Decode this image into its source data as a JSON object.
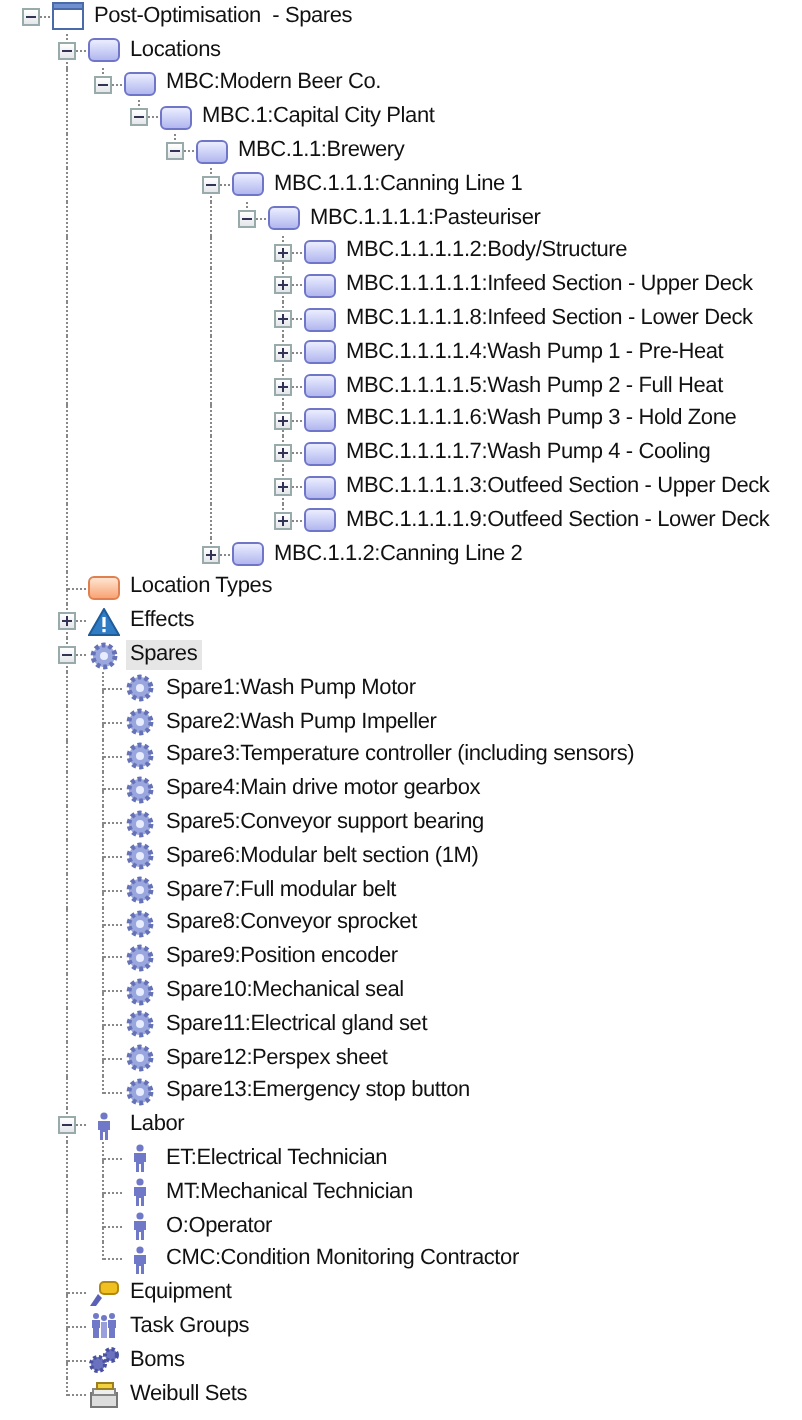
{
  "tree": {
    "label": "Post-Optimisation  - Spares",
    "kind": "root",
    "expanded": true,
    "selected": false,
    "children": [
      {
        "label": "Locations",
        "kind": "location",
        "expanded": true,
        "selected": false,
        "children": [
          {
            "label": "MBC:Modern Beer Co.",
            "kind": "location",
            "expanded": true,
            "selected": false,
            "children": [
              {
                "label": "MBC.1:Capital City Plant",
                "kind": "location",
                "expanded": true,
                "selected": false,
                "children": [
                  {
                    "label": "MBC.1.1:Brewery",
                    "kind": "location",
                    "expanded": true,
                    "selected": false,
                    "children": [
                      {
                        "label": "MBC.1.1.1:Canning Line 1",
                        "kind": "location",
                        "expanded": true,
                        "selected": false,
                        "children": [
                          {
                            "label": "MBC.1.1.1.1:Pasteuriser",
                            "kind": "location",
                            "expanded": true,
                            "selected": false,
                            "children": [
                              {
                                "label": "MBC.1.1.1.1.2:Body/Structure",
                                "kind": "location",
                                "expanded": false,
                                "selected": false
                              },
                              {
                                "label": "MBC.1.1.1.1.1:Infeed Section - Upper Deck",
                                "kind": "location",
                                "expanded": false,
                                "selected": false
                              },
                              {
                                "label": "MBC.1.1.1.1.8:Infeed Section - Lower Deck",
                                "kind": "location",
                                "expanded": false,
                                "selected": false
                              },
                              {
                                "label": "MBC.1.1.1.1.4:Wash Pump 1 - Pre-Heat",
                                "kind": "location",
                                "expanded": false,
                                "selected": false
                              },
                              {
                                "label": "MBC.1.1.1.1.5:Wash Pump 2 - Full Heat",
                                "kind": "location",
                                "expanded": false,
                                "selected": false
                              },
                              {
                                "label": "MBC.1.1.1.1.6:Wash Pump 3 - Hold Zone",
                                "kind": "location",
                                "expanded": false,
                                "selected": false
                              },
                              {
                                "label": "MBC.1.1.1.1.7:Wash Pump 4 - Cooling",
                                "kind": "location",
                                "expanded": false,
                                "selected": false
                              },
                              {
                                "label": "MBC.1.1.1.1.3:Outfeed Section - Upper Deck",
                                "kind": "location",
                                "expanded": false,
                                "selected": false
                              },
                              {
                                "label": "MBC.1.1.1.1.9:Outfeed Section - Lower Deck",
                                "kind": "location",
                                "expanded": false,
                                "selected": false
                              }
                            ]
                          }
                        ]
                      },
                      {
                        "label": "MBC.1.1.2:Canning Line 2",
                        "kind": "location",
                        "expanded": false,
                        "selected": false
                      }
                    ]
                  }
                ]
              }
            ]
          }
        ]
      },
      {
        "label": "Location Types",
        "kind": "location-type",
        "selected": false
      },
      {
        "label": "Effects",
        "kind": "effect",
        "expanded": false,
        "selected": false
      },
      {
        "label": "Spares",
        "kind": "spare",
        "expanded": true,
        "selected": true,
        "children": [
          {
            "label": "Spare1:Wash Pump Motor",
            "kind": "spare",
            "selected": false
          },
          {
            "label": "Spare2:Wash Pump Impeller",
            "kind": "spare",
            "selected": false
          },
          {
            "label": "Spare3:Temperature controller (including sensors)",
            "kind": "spare",
            "selected": false
          },
          {
            "label": "Spare4:Main drive motor gearbox",
            "kind": "spare",
            "selected": false
          },
          {
            "label": "Spare5:Conveyor support bearing",
            "kind": "spare",
            "selected": false
          },
          {
            "label": "Spare6:Modular belt section (1M)",
            "kind": "spare",
            "selected": false
          },
          {
            "label": "Spare7:Full modular belt",
            "kind": "spare",
            "selected": false
          },
          {
            "label": "Spare8:Conveyor sprocket",
            "kind": "spare",
            "selected": false
          },
          {
            "label": "Spare9:Position encoder",
            "kind": "spare",
            "selected": false
          },
          {
            "label": "Spare10:Mechanical seal",
            "kind": "spare",
            "selected": false
          },
          {
            "label": "Spare11:Electrical gland set",
            "kind": "spare",
            "selected": false
          },
          {
            "label": "Spare12:Perspex sheet",
            "kind": "spare",
            "selected": false
          },
          {
            "label": "Spare13:Emergency stop button",
            "kind": "spare",
            "selected": false
          }
        ]
      },
      {
        "label": "Labor",
        "kind": "labor",
        "expanded": true,
        "selected": false,
        "children": [
          {
            "label": "ET:Electrical Technician",
            "kind": "labor",
            "selected": false
          },
          {
            "label": "MT:Mechanical Technician",
            "kind": "labor",
            "selected": false
          },
          {
            "label": "O:Operator",
            "kind": "labor",
            "selected": false
          },
          {
            "label": "CMC:Condition Monitoring Contractor",
            "kind": "labor",
            "selected": false
          }
        ]
      },
      {
        "label": "Equipment",
        "kind": "equipment",
        "selected": false
      },
      {
        "label": "Task Groups",
        "kind": "task-group",
        "selected": false
      },
      {
        "label": "Boms",
        "kind": "bom",
        "selected": false
      },
      {
        "label": "Weibull Sets",
        "kind": "weibull",
        "selected": false
      }
    ]
  }
}
